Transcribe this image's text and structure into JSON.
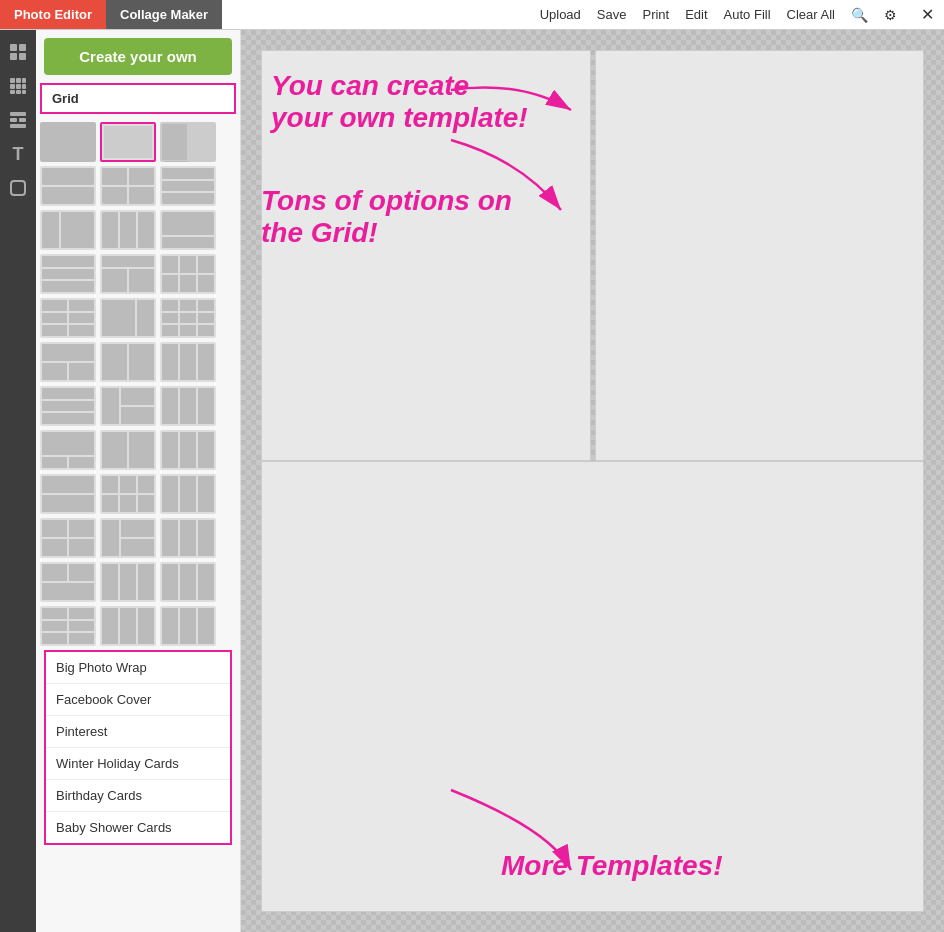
{
  "tabs": {
    "photo_editor": "Photo Editor",
    "collage_maker": "Collage Maker"
  },
  "toolbar": {
    "upload": "Upload",
    "save": "Save",
    "print": "Print",
    "edit": "Edit",
    "auto_fill": "Auto Fill",
    "clear_all": "Clear All"
  },
  "sidebar": {
    "create_own_label": "Create your own",
    "grid_label": "Grid",
    "more_templates": [
      "Big Photo Wrap",
      "Facebook Cover",
      "Pinterest",
      "Winter Holiday Cards",
      "Birthday Cards",
      "Baby Shower Cards"
    ]
  },
  "annotations": {
    "ann1_line1": "You can create",
    "ann1_line2": "your own template!",
    "ann2_line1": "Tons of options on",
    "ann2_line2": "the Grid!",
    "ann3": "More Templates!"
  }
}
